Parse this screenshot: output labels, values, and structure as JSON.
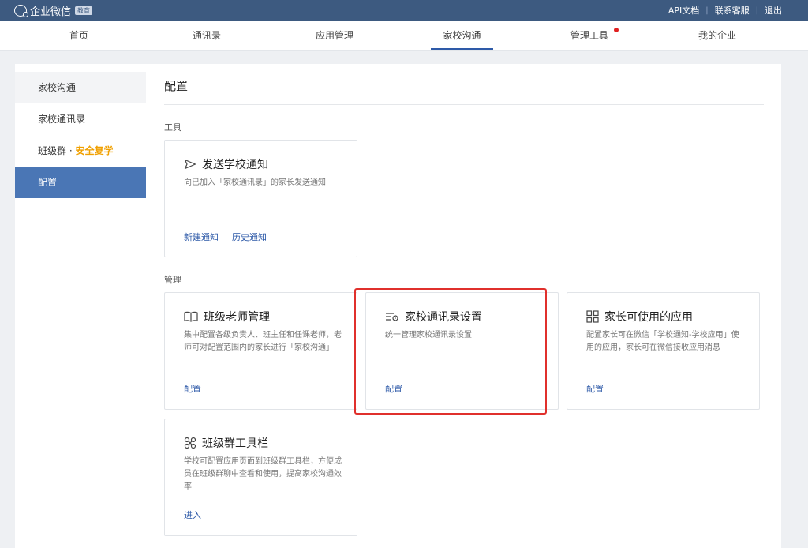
{
  "topbar": {
    "logo_text": "企业微信",
    "logo_badge": "教育",
    "links": [
      "API文档",
      "联系客服",
      "退出"
    ]
  },
  "nav": {
    "items": [
      "首页",
      "通讯录",
      "应用管理",
      "家校沟通",
      "管理工具",
      "我的企业"
    ],
    "active": "家校沟通"
  },
  "sidebar": {
    "items": [
      "家校沟通",
      "家校通讯录",
      "班级群",
      "配置"
    ],
    "item3_suffix_sep": "·",
    "item3_highlight": "安全复学",
    "active": "配置"
  },
  "content": {
    "title": "配置",
    "section_tools": "工具",
    "section_manage": "管理",
    "cards": [
      {
        "icon": "send-icon",
        "title": "发送学校通知",
        "desc": "向已加入「家校通讯录」的家长发送通知",
        "links": [
          "新建通知",
          "历史通知"
        ]
      },
      {
        "icon": "book-icon",
        "title": "班级老师管理",
        "desc": "集中配置各级负责人、班主任和任课老师，老师可对配置范围内的家长进行「家校沟通」",
        "links": [
          "配置"
        ]
      },
      {
        "icon": "list-settings-icon",
        "title": "家校通讯录设置",
        "desc": "统一管理家校通讯录设置",
        "links": [
          "配置"
        ]
      },
      {
        "icon": "grid-icon",
        "title": "家长可使用的应用",
        "desc": "配置家长可在微信「学校通知-学校应用」使用的应用，家长可在微信接收应用消息",
        "links": [
          "配置"
        ]
      },
      {
        "icon": "toolbar-icon",
        "title": "班级群工具栏",
        "desc": "学校可配置应用页面到班级群工具栏，方便成员在班级群聊中查看和使用，提高家校沟通效率",
        "links": [
          "进入"
        ]
      }
    ]
  },
  "colors": {
    "topbar": "#3d5a80",
    "accent": "#2e5aa8",
    "sidebar_active": "#4a76b5",
    "highlight_text": "#f0a000",
    "annotation_red": "#e0302c"
  }
}
